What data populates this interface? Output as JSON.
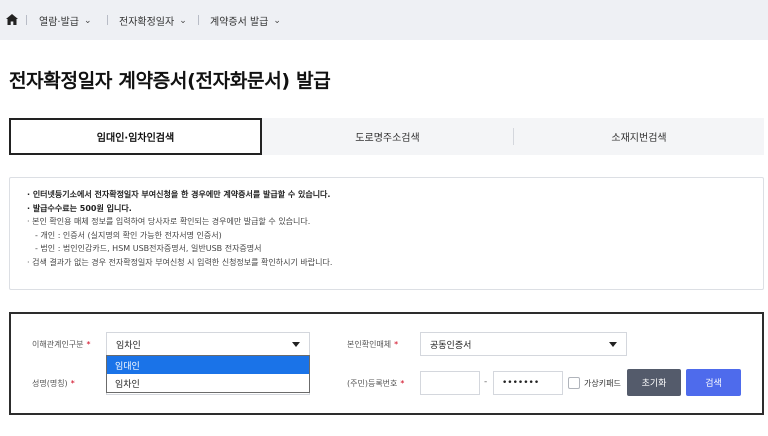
{
  "breadcrumb": {
    "items": [
      {
        "label": "열람·발급"
      },
      {
        "label": "전자확정일자"
      },
      {
        "label": "계약증서 발급"
      }
    ]
  },
  "page": {
    "title": "전자확정일자 계약증서(전자화문서) 발급"
  },
  "tabs": [
    {
      "label": "임대인·임차인검색",
      "active": true
    },
    {
      "label": "도로명주소검색",
      "active": false
    },
    {
      "label": "소재지번검색",
      "active": false
    }
  ],
  "notice": {
    "lines": [
      "· 인터넷등기소에서 전자확정일자 부여신청을 한 경우에만 계약증서를 발급할 수 있습니다.",
      "· 발급수수료는 500원 입니다.",
      "· 본인 확인용 매체 정보를 입력하여 당사자로 확인되는 경우에만 발급할 수 있습니다.",
      "- 개인 : 인증서 (실지명의 확인 가능한 전자서명 인증서)",
      "- 법인 : 법인인감카드, HSM USB전자증명서, 일반USB 전자증명서",
      "· 검색 결과가 없는 경우 전자확정일자 부여신청 시 입력한 신청정보를 확인하시기 바랍니다."
    ]
  },
  "form": {
    "relation": {
      "label": "이해관계인구분",
      "required_mark": "*",
      "value": "임차인",
      "options": [
        "임대인",
        "임차인"
      ],
      "highlighted": "임대인"
    },
    "auth_media": {
      "label": "본인확인매체",
      "required_mark": "*",
      "value": "공동인증서"
    },
    "name": {
      "label": "성명(명칭)",
      "required_mark": "*",
      "value": ""
    },
    "reg_no": {
      "label": "(주민)등록번호",
      "required_mark": "*",
      "front": "",
      "dash": "-",
      "back": "•••••••"
    },
    "virtual_keypad": {
      "label": "가상키패드",
      "checked": false
    },
    "reset_label": "초기화",
    "search_label": "검색"
  },
  "colors": {
    "primary": "#4e6bec",
    "reset": "#545b6b",
    "required": "#d0021b",
    "highlight": "#1a73e8"
  }
}
